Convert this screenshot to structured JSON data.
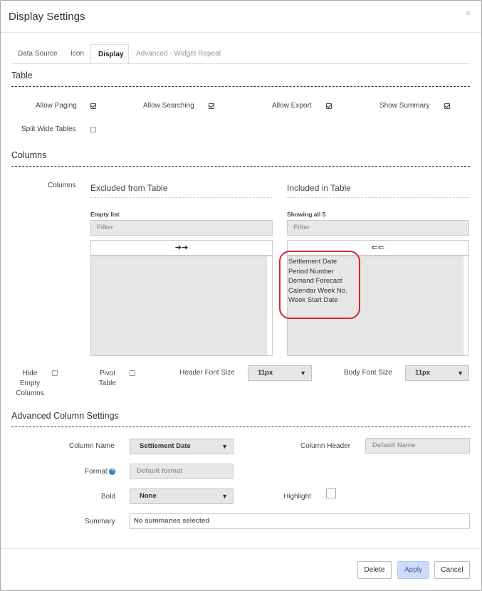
{
  "dialog": {
    "title": "Display Settings",
    "close_glyph": "×"
  },
  "tabs": [
    {
      "label": "Data Source",
      "state": "normal"
    },
    {
      "label": "Icon",
      "state": "normal"
    },
    {
      "label": "Display",
      "state": "active"
    },
    {
      "label": "Advanced - Widget Repeat",
      "state": "muted"
    }
  ],
  "table_section": {
    "heading": "Table",
    "allow_paging": {
      "label": "Allow Paging",
      "checked": true
    },
    "allow_searching": {
      "label": "Allow Searching",
      "checked": true
    },
    "allow_export": {
      "label": "Allow Export",
      "checked": true
    },
    "show_summary": {
      "label": "Show Summary",
      "checked": true
    },
    "split_wide": {
      "label": "Split Wide Tables",
      "checked": false
    }
  },
  "columns_section": {
    "heading": "Columns",
    "columns_label": "Columns",
    "excluded": {
      "heading": "Excluded from Table",
      "status": "Empty list",
      "filter_placeholder": "Filter",
      "move_arrows": "➔➔",
      "items": []
    },
    "included": {
      "heading": "Included in Table",
      "status": "Showing all 5",
      "filter_placeholder": "Filter",
      "move_arrows": "⇐⇐",
      "items": [
        "Settlement Date",
        "Period Number",
        "Demand Forecast",
        "Calendar Week No.",
        "Week Start Date"
      ]
    },
    "hide_empty": {
      "label_line1": "Hide",
      "label_line2": "Empty",
      "label_line3": "Columns",
      "checked": false
    },
    "pivot": {
      "label_line1": "Pivot",
      "label_line2": "Table",
      "checked": false
    },
    "header_font": {
      "label": "Header Font Size",
      "value": "11px"
    },
    "body_font": {
      "label": "Body Font Size",
      "value": "11px"
    }
  },
  "advanced_section": {
    "heading": "Advanced Column Settings",
    "column_name": {
      "label": "Column Name",
      "value": "Settlement Date"
    },
    "column_header": {
      "label": "Column Header",
      "placeholder": "Default Name"
    },
    "format": {
      "label": "Format",
      "placeholder": "Default format",
      "help_glyph": "?"
    },
    "bold": {
      "label": "Bold",
      "value": "None"
    },
    "highlight": {
      "label": "Highlight",
      "checked": false
    },
    "summary": {
      "label": "Summary",
      "value": "No summaries selected"
    }
  },
  "footer": {
    "delete_label": "Delete",
    "apply_label": "Apply",
    "cancel_label": "Cancel"
  },
  "colors": {
    "accent": "#2d7bd0",
    "annotation_red": "#d9232e",
    "apply_bg": "#cfdcf9"
  }
}
